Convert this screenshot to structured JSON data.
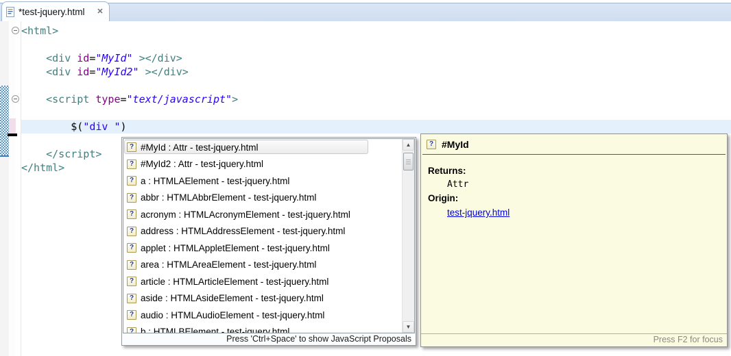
{
  "tab_bar": {
    "tab_title": "*test-jquery.html"
  },
  "icons": {
    "close": "✕",
    "question": "?",
    "scroll_up": "▲",
    "scroll_down": "▼"
  },
  "editor": {
    "code": {
      "lines": [
        {
          "indent": 0,
          "fold": true,
          "tokens": [
            [
              "tag",
              "<html>"
            ]
          ]
        },
        {
          "indent": 0,
          "tokens": []
        },
        {
          "indent": 1,
          "tokens": [
            [
              "tag",
              "<div "
            ],
            [
              "attr",
              "id"
            ],
            [
              "plain",
              "="
            ],
            [
              "value",
              "\"MyId\""
            ],
            [
              "tag",
              " ></div>"
            ]
          ]
        },
        {
          "indent": 1,
          "tokens": [
            [
              "tag",
              "<div "
            ],
            [
              "attr",
              "id"
            ],
            [
              "plain",
              "="
            ],
            [
              "value",
              "\"MyId2\""
            ],
            [
              "tag",
              " ></div>"
            ]
          ]
        },
        {
          "indent": 0,
          "tokens": []
        },
        {
          "indent": 1,
          "fold": true,
          "tokens": [
            [
              "tag",
              "<script "
            ],
            [
              "attr",
              "type"
            ],
            [
              "plain",
              "="
            ],
            [
              "value",
              "\"text/javascript\""
            ],
            [
              "tag",
              ">"
            ]
          ]
        },
        {
          "indent": 0,
          "tokens": []
        },
        {
          "indent": 2,
          "current": true,
          "tokens": [
            [
              "plain",
              "$("
            ],
            [
              "string",
              "\"div \""
            ],
            [
              "plain",
              ")"
            ]
          ]
        },
        {
          "indent": 0,
          "tokens": []
        },
        {
          "indent": 1,
          "tokens": [
            [
              "tag",
              "</script>"
            ]
          ]
        },
        {
          "indent": 0,
          "tokens": [
            [
              "tag",
              "</html>"
            ]
          ]
        }
      ]
    }
  },
  "completion_popup": {
    "items": [
      {
        "label": "#MyId : Attr - test-jquery.html",
        "selected": true
      },
      {
        "label": "#MyId2 : Attr - test-jquery.html"
      },
      {
        "label": "a : HTMLAElement - test-jquery.html"
      },
      {
        "label": "abbr : HTMLAbbrElement - test-jquery.html"
      },
      {
        "label": "acronym : HTMLAcronymElement - test-jquery.html"
      },
      {
        "label": "address : HTMLAddressElement - test-jquery.html"
      },
      {
        "label": "applet : HTMLAppletElement - test-jquery.html"
      },
      {
        "label": "area : HTMLAreaElement - test-jquery.html"
      },
      {
        "label": "article : HTMLArticleElement - test-jquery.html"
      },
      {
        "label": "aside : HTMLAsideElement - test-jquery.html"
      },
      {
        "label": "audio : HTMLAudioElement - test-jquery.html"
      },
      {
        "label": "b : HTMLBElement - test-jquery.html"
      }
    ],
    "status": "Press 'Ctrl+Space' to show JavaScript Proposals"
  },
  "doc_popup": {
    "title": "#MyId",
    "returns_label": "Returns:",
    "returns_value": "Attr",
    "origin_label": "Origin:",
    "origin_link": "test-jquery.html",
    "footer": "Press F2 for focus"
  },
  "colors": {
    "tag": "#3F7F7F",
    "attribute_name": "#7F007F",
    "attribute_value": "#2A00FF",
    "js_string": "#2A00FF",
    "current_line_highlight": "#E4F0FC",
    "doc_popup_bg": "#FBFBE2",
    "link": "#0000D8",
    "tab_strip_bg": "#D4E1F2",
    "range_indicator_blue": "#5E96C8",
    "diff_changed_pink": "#F2DEEA"
  }
}
